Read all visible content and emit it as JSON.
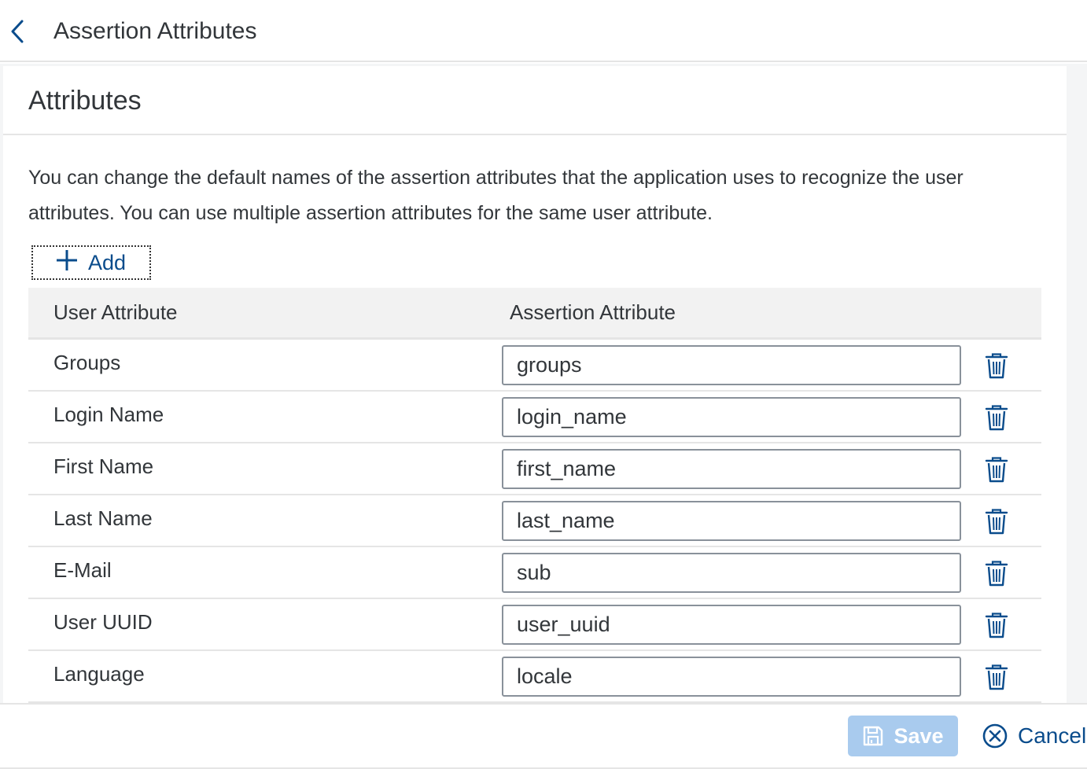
{
  "header": {
    "back_icon": "chevron-left-icon",
    "title": "Assertion Attributes"
  },
  "panel": {
    "title": "Attributes",
    "description": "You can change the default names of the assertion attributes that the application uses to recognize the user attributes. You can use multiple assertion attributes for the same user attribute.",
    "add_button": {
      "icon": "plus-icon",
      "label": "Add"
    }
  },
  "table": {
    "columns": [
      "User Attribute",
      "Assertion Attribute"
    ],
    "rows": [
      {
        "user_attribute": "Groups",
        "assertion_attribute": "groups"
      },
      {
        "user_attribute": "Login Name",
        "assertion_attribute": "login_name"
      },
      {
        "user_attribute": "First Name",
        "assertion_attribute": "first_name"
      },
      {
        "user_attribute": "Last Name",
        "assertion_attribute": "last_name"
      },
      {
        "user_attribute": "E-Mail",
        "assertion_attribute": "sub"
      },
      {
        "user_attribute": "User UUID",
        "assertion_attribute": "user_uuid"
      },
      {
        "user_attribute": "Language",
        "assertion_attribute": "locale"
      }
    ],
    "delete_icon": "trash-icon"
  },
  "footer": {
    "save": {
      "icon": "save-icon",
      "label": "Save",
      "enabled": false
    },
    "cancel": {
      "icon": "cancel-circle-icon",
      "label": "Cancel"
    }
  },
  "colors": {
    "accent": "#0a4c8c",
    "save_disabled": "#a9cbee",
    "border": "#89919a"
  }
}
